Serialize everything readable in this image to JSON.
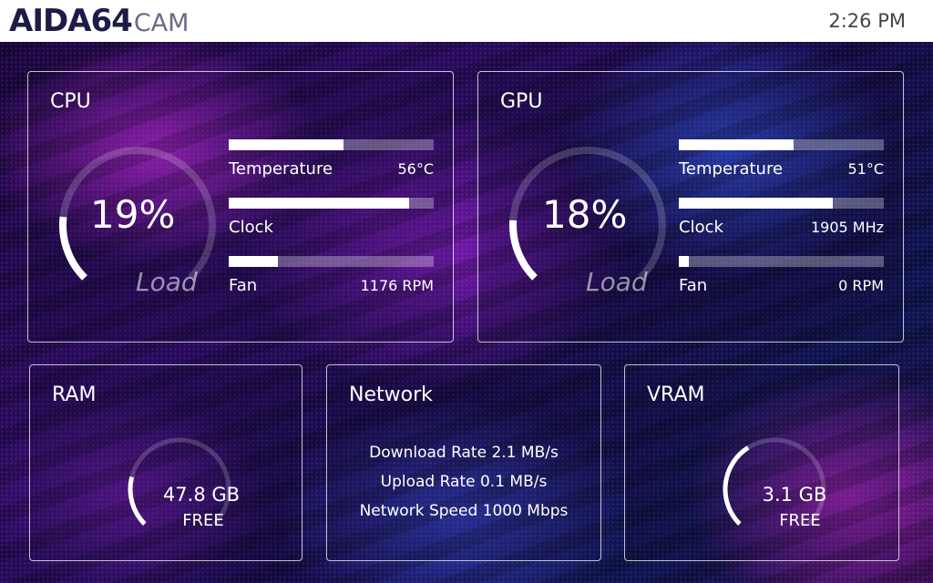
{
  "header": {
    "logo_main": "AIDA64",
    "logo_sub": "CAM",
    "time": "2:26 PM"
  },
  "cpu": {
    "title": "CPU",
    "load_value": "19%",
    "load_fraction": 0.19,
    "load_label": "Load",
    "metrics": [
      {
        "label": "Temperature",
        "value": "56°C",
        "fill": 0.56
      },
      {
        "label": "Clock",
        "value": "",
        "fill": 0.88
      },
      {
        "label": "Fan",
        "value": "1176 RPM",
        "fill": 0.24
      }
    ]
  },
  "gpu": {
    "title": "GPU",
    "load_value": "18%",
    "load_fraction": 0.18,
    "load_label": "Load",
    "metrics": [
      {
        "label": "Temperature",
        "value": "51°C",
        "fill": 0.56
      },
      {
        "label": "Clock",
        "value": "1905 MHz",
        "fill": 0.75
      },
      {
        "label": "Fan",
        "value": "0 RPM",
        "fill": 0.05
      }
    ]
  },
  "ram": {
    "title": "RAM",
    "value": "47.8 GB",
    "free_label": "FREE",
    "fraction": 0.22
  },
  "network": {
    "title": "Network",
    "download": "Download Rate 2.1 MB/s",
    "upload": "Upload Rate 0.1 MB/s",
    "speed": "Network Speed 1000 Mbps"
  },
  "vram": {
    "title": "VRAM",
    "value": "3.1 GB",
    "free_label": "FREE",
    "fraction": 0.38
  }
}
